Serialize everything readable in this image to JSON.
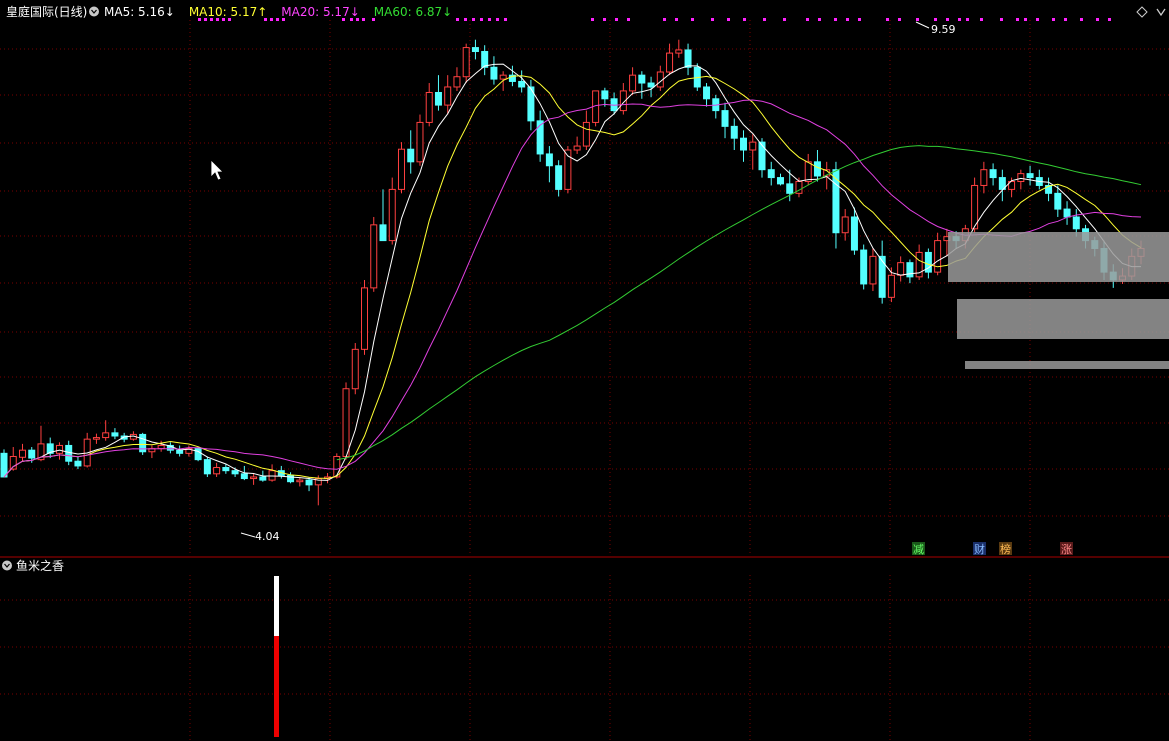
{
  "header": {
    "stock_label": "皇庭国际(日线)",
    "ma_items": [
      {
        "label": "MA5: 5.16",
        "arrow": "↓",
        "color": "#ffffff"
      },
      {
        "label": "MA10: 5.17",
        "arrow": "↑",
        "color": "#ffff33"
      },
      {
        "label": "MA20: 5.17",
        "arrow": "↓",
        "color": "#ff44ff"
      },
      {
        "label": "MA60: 6.87",
        "arrow": "↓",
        "color": "#33dd33"
      }
    ]
  },
  "indicator_panel": {
    "label": "鱼米之香"
  },
  "colors": {
    "up": "#ff4040",
    "down": "#54ffff",
    "grid": "#7a0000",
    "ma5": "#ffffff",
    "ma10": "#ffff33",
    "ma20": "#e040e0",
    "ma60": "#33cc33",
    "gap_box": "#9a9a9a",
    "marker": "#ff22ff"
  },
  "chart_data": {
    "type": "candlestick",
    "title": "皇庭国际(日线)",
    "ylim": [
      3.6,
      10.2
    ],
    "high_label": "9.59",
    "low_label": "4.04",
    "candles": [
      [
        4.7,
        4.75,
        4.45,
        4.4
      ],
      [
        4.5,
        4.78,
        4.48,
        4.66
      ],
      [
        4.65,
        4.82,
        4.6,
        4.74
      ],
      [
        4.74,
        4.78,
        4.58,
        4.64
      ],
      [
        4.62,
        5.05,
        4.6,
        4.82
      ],
      [
        4.82,
        4.9,
        4.64,
        4.7
      ],
      [
        4.7,
        4.84,
        4.62,
        4.8
      ],
      [
        4.8,
        4.86,
        4.55,
        4.6
      ],
      [
        4.6,
        4.66,
        4.5,
        4.54
      ],
      [
        4.54,
        4.96,
        4.52,
        4.88
      ],
      [
        4.88,
        4.95,
        4.82,
        4.9
      ],
      [
        4.9,
        5.12,
        4.86,
        4.96
      ],
      [
        4.96,
        5.02,
        4.88,
        4.92
      ],
      [
        4.92,
        4.96,
        4.84,
        4.88
      ],
      [
        4.88,
        4.98,
        4.86,
        4.94
      ],
      [
        4.94,
        4.96,
        4.68,
        4.72
      ],
      [
        4.72,
        4.8,
        4.64,
        4.76
      ],
      [
        4.76,
        4.86,
        4.72,
        4.8
      ],
      [
        4.8,
        4.84,
        4.7,
        4.74
      ],
      [
        4.74,
        4.8,
        4.66,
        4.7
      ],
      [
        4.7,
        4.8,
        4.66,
        4.76
      ],
      [
        4.76,
        4.78,
        4.6,
        4.62
      ],
      [
        4.62,
        4.66,
        4.4,
        4.44
      ],
      [
        4.44,
        4.58,
        4.4,
        4.52
      ],
      [
        4.52,
        4.56,
        4.44,
        4.48
      ],
      [
        4.48,
        4.52,
        4.4,
        4.44
      ],
      [
        4.44,
        4.54,
        4.36,
        4.38
      ],
      [
        4.38,
        4.44,
        4.3,
        4.4
      ],
      [
        4.4,
        4.48,
        4.34,
        4.36
      ],
      [
        4.36,
        4.56,
        4.34,
        4.48
      ],
      [
        4.48,
        4.54,
        4.38,
        4.42
      ],
      [
        4.42,
        4.46,
        4.32,
        4.34
      ],
      [
        4.34,
        4.4,
        4.28,
        4.36
      ],
      [
        4.36,
        4.4,
        4.22,
        4.3
      ],
      [
        4.3,
        4.42,
        4.04,
        4.38
      ],
      [
        4.38,
        4.45,
        4.32,
        4.4
      ],
      [
        4.4,
        4.7,
        4.38,
        4.66
      ],
      [
        4.66,
        5.6,
        4.62,
        5.52
      ],
      [
        5.52,
        6.1,
        5.45,
        6.02
      ],
      [
        6.02,
        6.9,
        5.95,
        6.8
      ],
      [
        6.8,
        7.7,
        6.75,
        7.6
      ],
      [
        7.6,
        8.05,
        7.55,
        7.4
      ],
      [
        7.4,
        8.2,
        7.35,
        8.05
      ],
      [
        8.05,
        8.65,
        8.0,
        8.56
      ],
      [
        8.56,
        8.8,
        8.25,
        8.4
      ],
      [
        8.4,
        9.0,
        8.35,
        8.9
      ],
      [
        8.9,
        9.4,
        8.85,
        9.28
      ],
      [
        9.28,
        9.5,
        9.05,
        9.12
      ],
      [
        9.12,
        9.5,
        9.0,
        9.35
      ],
      [
        9.35,
        9.6,
        9.3,
        9.48
      ],
      [
        9.48,
        9.9,
        9.4,
        9.85
      ],
      [
        9.85,
        9.95,
        9.7,
        9.8
      ],
      [
        9.8,
        9.88,
        9.5,
        9.6
      ],
      [
        9.6,
        9.74,
        9.38,
        9.45
      ],
      [
        9.45,
        9.55,
        9.3,
        9.5
      ],
      [
        9.5,
        9.62,
        9.36,
        9.42
      ],
      [
        9.42,
        9.56,
        9.28,
        9.35
      ],
      [
        9.35,
        9.44,
        8.8,
        8.92
      ],
      [
        8.92,
        9.05,
        8.4,
        8.5
      ],
      [
        8.5,
        8.6,
        8.14,
        8.35
      ],
      [
        8.35,
        8.42,
        7.96,
        8.05
      ],
      [
        8.05,
        8.6,
        8.0,
        8.55
      ],
      [
        8.55,
        8.72,
        8.5,
        8.6
      ],
      [
        8.6,
        9.05,
        8.55,
        8.9
      ],
      [
        8.9,
        9.2,
        8.85,
        9.3
      ],
      [
        9.3,
        9.34,
        9.1,
        9.2
      ],
      [
        9.2,
        9.28,
        9.0,
        9.05
      ],
      [
        9.05,
        9.4,
        9.0,
        9.3
      ],
      [
        9.3,
        9.6,
        9.25,
        9.5
      ],
      [
        9.5,
        9.55,
        9.2,
        9.4
      ],
      [
        9.4,
        9.48,
        9.22,
        9.35
      ],
      [
        9.35,
        9.62,
        9.3,
        9.54
      ],
      [
        9.54,
        9.9,
        9.5,
        9.78
      ],
      [
        9.78,
        9.95,
        9.72,
        9.82
      ],
      [
        9.82,
        9.9,
        9.5,
        9.6
      ],
      [
        9.6,
        9.65,
        9.3,
        9.35
      ],
      [
        9.35,
        9.4,
        9.1,
        9.2
      ],
      [
        9.2,
        9.25,
        8.95,
        9.05
      ],
      [
        9.05,
        9.15,
        8.7,
        8.85
      ],
      [
        8.85,
        8.95,
        8.55,
        8.7
      ],
      [
        8.7,
        8.8,
        8.4,
        8.55
      ],
      [
        8.55,
        8.75,
        8.3,
        8.65
      ],
      [
        8.65,
        8.7,
        8.2,
        8.3
      ],
      [
        8.3,
        8.4,
        8.1,
        8.2
      ],
      [
        8.2,
        8.25,
        8.1,
        8.12
      ],
      [
        8.12,
        8.3,
        7.9,
        8.0
      ],
      [
        8.0,
        8.2,
        7.95,
        8.15
      ],
      [
        8.15,
        8.5,
        8.1,
        8.4
      ],
      [
        8.4,
        8.55,
        8.15,
        8.22
      ],
      [
        8.22,
        8.4,
        8.05,
        8.3
      ],
      [
        8.3,
        8.4,
        7.3,
        7.5
      ],
      [
        7.5,
        7.8,
        7.4,
        7.7
      ],
      [
        7.7,
        7.82,
        7.22,
        7.28
      ],
      [
        7.28,
        7.35,
        6.78,
        6.85
      ],
      [
        6.85,
        7.3,
        6.76,
        7.2
      ],
      [
        7.2,
        7.4,
        6.6,
        6.68
      ],
      [
        6.68,
        7.06,
        6.62,
        6.96
      ],
      [
        6.96,
        7.2,
        6.88,
        7.12
      ],
      [
        7.12,
        7.16,
        6.86,
        6.94
      ],
      [
        6.94,
        7.35,
        6.9,
        7.25
      ],
      [
        7.25,
        7.3,
        6.92,
        7.0
      ],
      [
        7.0,
        7.5,
        6.96,
        7.4
      ],
      [
        7.4,
        7.55,
        7.2,
        7.45
      ],
      [
        7.45,
        7.52,
        7.3,
        7.4
      ],
      [
        7.4,
        7.6,
        7.3,
        7.55
      ],
      [
        7.55,
        8.2,
        7.5,
        8.1
      ],
      [
        8.1,
        8.4,
        8.0,
        8.3
      ],
      [
        8.3,
        8.38,
        8.1,
        8.2
      ],
      [
        8.2,
        8.3,
        7.9,
        8.05
      ],
      [
        8.05,
        8.2,
        7.95,
        8.15
      ],
      [
        8.15,
        8.3,
        8.05,
        8.25
      ],
      [
        8.25,
        8.35,
        8.1,
        8.2
      ],
      [
        8.2,
        8.3,
        8.05,
        8.1
      ],
      [
        8.1,
        8.2,
        7.9,
        8.0
      ],
      [
        8.0,
        8.1,
        7.7,
        7.8
      ],
      [
        7.8,
        7.9,
        7.6,
        7.7
      ],
      [
        7.7,
        7.8,
        7.45,
        7.55
      ],
      [
        7.55,
        7.6,
        7.3,
        7.4
      ],
      [
        7.4,
        7.45,
        7.2,
        7.3
      ],
      [
        7.3,
        7.4,
        6.9,
        7.0
      ],
      [
        7.0,
        7.1,
        6.8,
        6.9
      ],
      [
        6.9,
        7.05,
        6.85,
        6.95
      ],
      [
        6.95,
        7.3,
        6.9,
        7.2
      ],
      [
        7.2,
        7.4,
        7.1,
        7.3
      ]
    ]
  }
}
